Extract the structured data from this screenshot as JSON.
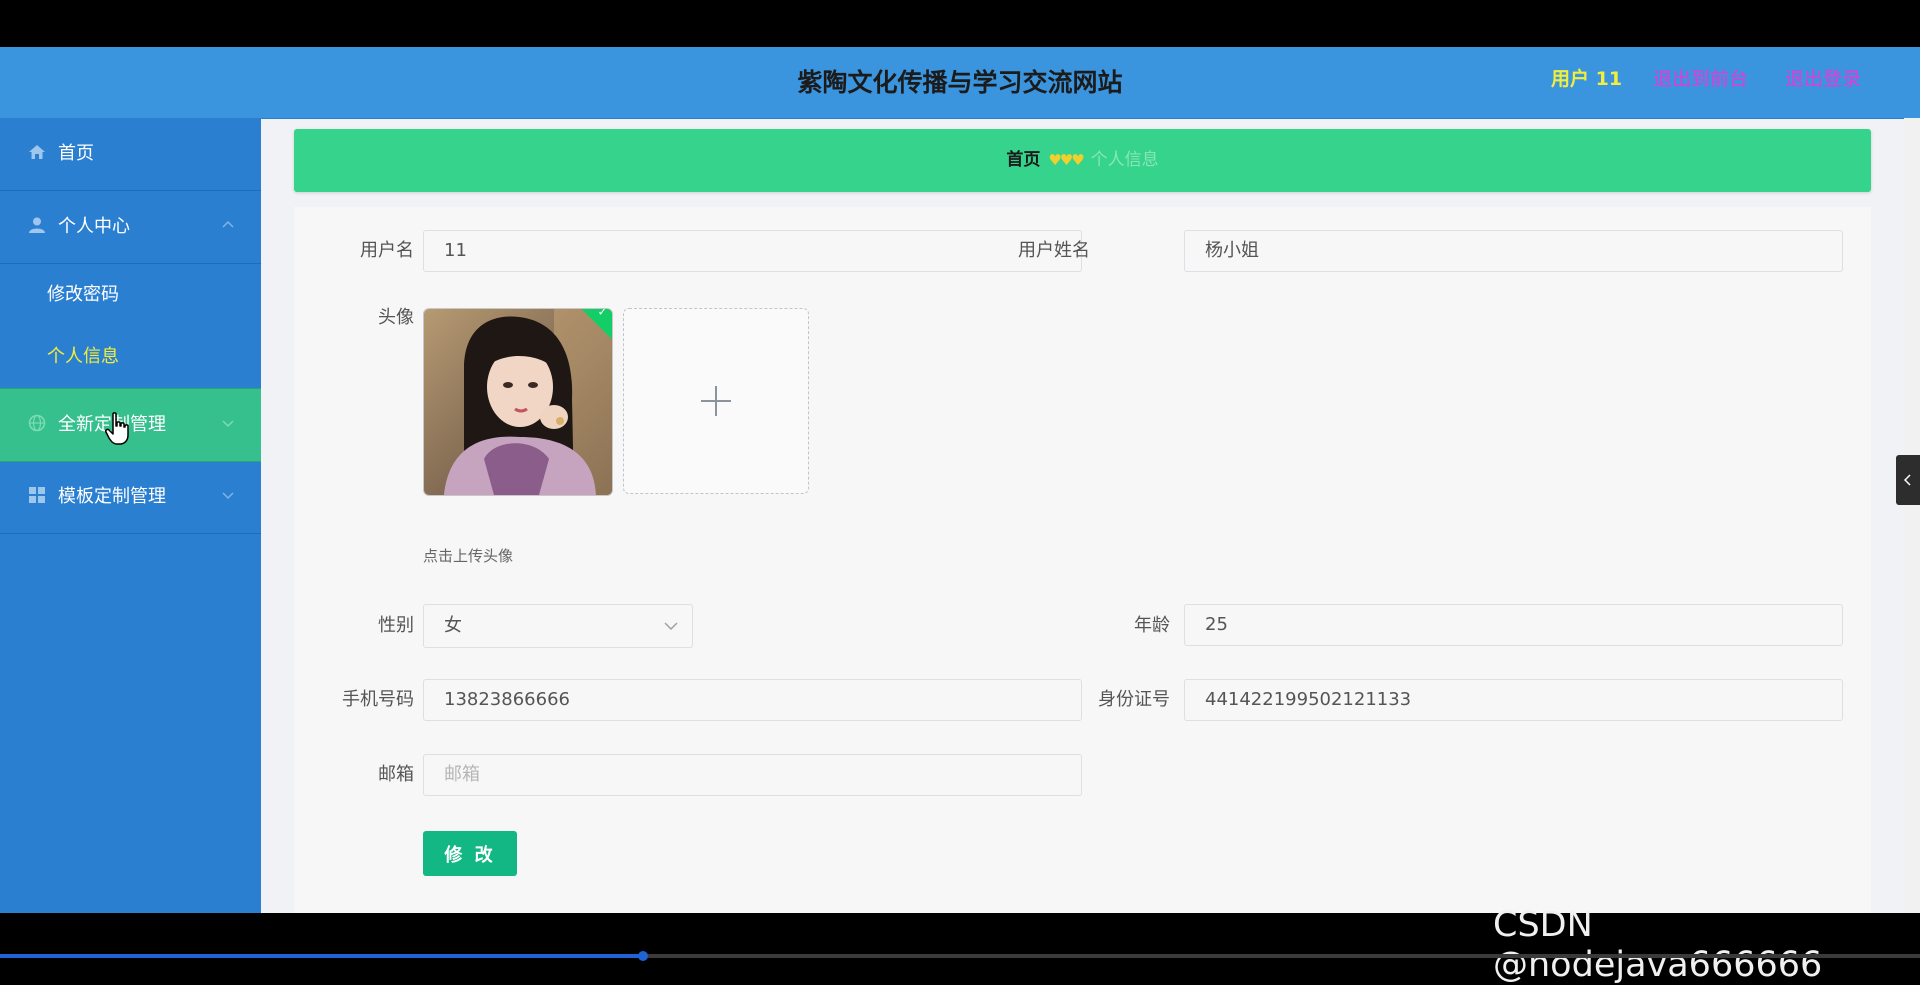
{
  "header": {
    "site_title": "紫陶文化传播与学习交流网站",
    "user": "用户 11",
    "back_to_front": "退出到前台",
    "logout": "退出登录"
  },
  "sidebar": {
    "home": "首页",
    "personal_center": "个人中心",
    "change_password": "修改密码",
    "personal_info": "个人信息",
    "full_custom": "全新定制管理",
    "template_custom": "模板定制管理"
  },
  "breadcrumb": {
    "home": "首页",
    "separator": "♥♥♥",
    "current": "个人信息"
  },
  "form": {
    "username_label": "用户名",
    "username_value": "11",
    "realname_label": "用户姓名",
    "realname_value": "杨小姐",
    "avatar_label": "头像",
    "upload_tip": "点击上传头像",
    "gender_label": "性别",
    "gender_value": "女",
    "age_label": "年龄",
    "age_value": "25",
    "phone_label": "手机号码",
    "phone_value": "13823866666",
    "idcard_label": "身份证号",
    "idcard_value": "441422199502121133",
    "email_label": "邮箱",
    "email_placeholder": "邮箱",
    "submit": "修 改"
  },
  "watermark": "CSDN @nodejava666666",
  "video_progress": 0.335,
  "colors": {
    "header_bg": "#3b95de",
    "sidebar_bg": "#2b7fd1",
    "active_menu_bg": "#36c08d",
    "breadcrumb_bg": "#36d38d",
    "submit_bg": "#13b783",
    "user_color": "#f2ee3d",
    "link_color": "#e23ad9"
  }
}
